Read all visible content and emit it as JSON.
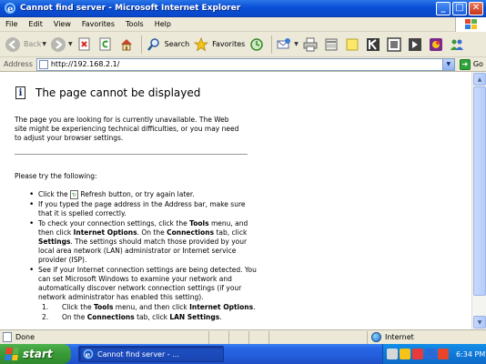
{
  "window": {
    "title": "Cannot find server - Microsoft Internet Explorer",
    "min_label": "_",
    "max_label": "□",
    "close_label": "✕"
  },
  "menu": [
    "File",
    "Edit",
    "View",
    "Favorites",
    "Tools",
    "Help"
  ],
  "toolbar": {
    "back_label": "Back",
    "search_label": "Search",
    "favorites_label": "Favorites"
  },
  "address": {
    "label": "Address",
    "url": "http://192.168.2.1/",
    "go_label": "Go"
  },
  "page": {
    "title": "The page cannot be displayed",
    "intro_line1": "The page you are looking for is currently unavailable. The Web",
    "intro_line2": "site might be experiencing technical difficulties, or you may need",
    "intro_line3": "to adjust your browser settings.",
    "try_heading": "Please try the following:",
    "tip1_pre": "Click the",
    "tip1_post": "Refresh button, or try again later.",
    "tip2": "If you typed the page address in the Address bar, make sure that it is spelled correctly.",
    "tip3_a": "To check your connection settings, click the ",
    "tip3_b": "Tools",
    "tip3_c": " menu, and then click ",
    "tip3_d": "Internet Options",
    "tip3_e": ". On the ",
    "tip3_f": "Connections",
    "tip3_g": " tab, click ",
    "tip3_h": "Settings",
    "tip3_i": ". The settings should match those provided by your local area network (LAN) administrator or Internet service provider (ISP).",
    "tip4": "See if your Internet connection settings are being detected. You can set Microsoft Windows to examine your network and automatically discover network connection settings (if your network administrator has enabled this setting).",
    "step1_num": "1.",
    "step1_a": "Click the ",
    "step1_b": "Tools",
    "step1_c": " menu, and then click ",
    "step1_d": "Internet Options",
    "step1_e": ".",
    "step2_num": "2.",
    "step2_a": "On the ",
    "step2_b": "Connections",
    "step2_c": " tab, click ",
    "step2_d": "LAN Settings",
    "step2_e": "."
  },
  "status": {
    "text": "Done",
    "zone": "Internet"
  },
  "taskbar": {
    "start_label": "start",
    "task_label": "Cannot find server - ...",
    "clock": "6:34 PM"
  },
  "colors": {
    "titlebar": "#0a4fd6",
    "chrome": "#ece9d8",
    "start": "#3c9d3a",
    "taskbar": "#245edb",
    "tray": "#0f78d8"
  }
}
